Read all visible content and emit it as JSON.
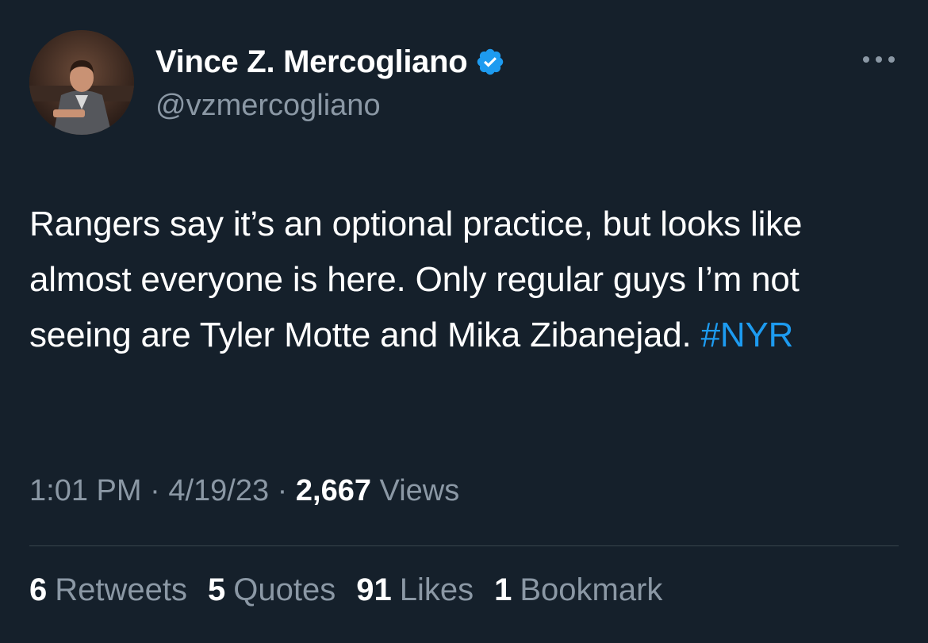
{
  "author": {
    "display_name": "Vince Z. Mercogliano",
    "handle": "@vzmercogliano",
    "verified": true
  },
  "tweet": {
    "text": "Rangers say it’s an optional practice, but looks like almost everyone is here. Only regular guys I’m not seeing are Tyler Motte and Mika Zibanejad. ",
    "hashtag": "#NYR"
  },
  "meta": {
    "time": "1:01 PM",
    "sep1": " · ",
    "date": "4/19/23",
    "sep2": " · ",
    "views_count": "2,667",
    "views_label": "Views"
  },
  "stats": {
    "retweets": {
      "count": "6",
      "label": "Retweets"
    },
    "quotes": {
      "count": "5",
      "label": "Quotes"
    },
    "likes": {
      "count": "91",
      "label": "Likes"
    },
    "bookmarks": {
      "count": "1",
      "label": "Bookmark"
    }
  },
  "icons": {
    "verified": "verified-badge-icon",
    "more": "more-options-icon"
  },
  "colors": {
    "background": "#15202b",
    "text_primary": "#ffffff",
    "text_secondary": "#8b98a5",
    "accent": "#1d9bf0",
    "divider": "#38444d"
  }
}
